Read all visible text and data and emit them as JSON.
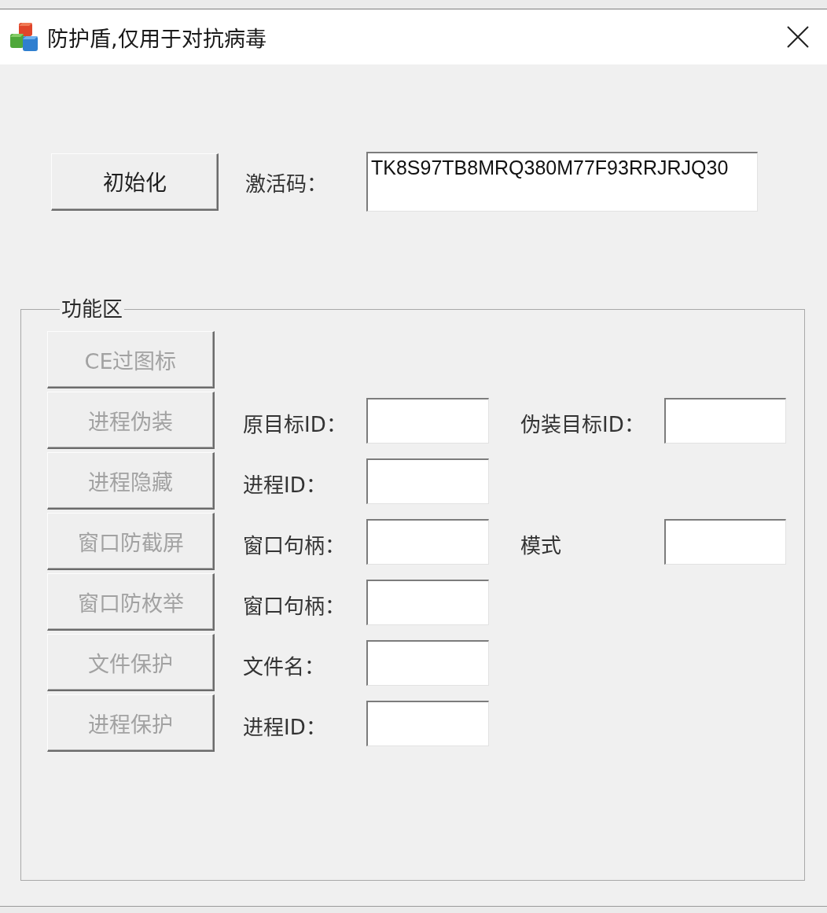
{
  "window": {
    "title": "防护盾,仅用于对抗病毒"
  },
  "activation": {
    "button": {
      "label": "初始化",
      "disabled": false
    },
    "label": "激活码：",
    "value": "TK8S97TB8MRQ380M77F93RRJRJQ30"
  },
  "function_area": {
    "title": "功能区",
    "rows": [
      {
        "button": {
          "label": "CE过图标",
          "disabled": true
        }
      },
      {
        "button": {
          "label": "进程伪装",
          "disabled": true
        },
        "fields": [
          {
            "label": "原目标ID："
          },
          {
            "label": "伪装目标ID："
          }
        ]
      },
      {
        "button": {
          "label": "进程隐藏",
          "disabled": true
        },
        "fields": [
          {
            "label": "进程ID："
          }
        ]
      },
      {
        "button": {
          "label": "窗口防截屏",
          "disabled": true
        },
        "fields": [
          {
            "label": "窗口句柄："
          },
          {
            "label": "模式"
          }
        ]
      },
      {
        "button": {
          "label": "窗口防枚举",
          "disabled": true
        },
        "fields": [
          {
            "label": "窗口句柄："
          }
        ]
      },
      {
        "button": {
          "label": "文件保护",
          "disabled": true
        },
        "fields": [
          {
            "label": "文件名："
          }
        ]
      },
      {
        "button": {
          "label": "进程保护",
          "disabled": true
        },
        "fields": [
          {
            "label": "进程ID："
          }
        ]
      }
    ]
  }
}
